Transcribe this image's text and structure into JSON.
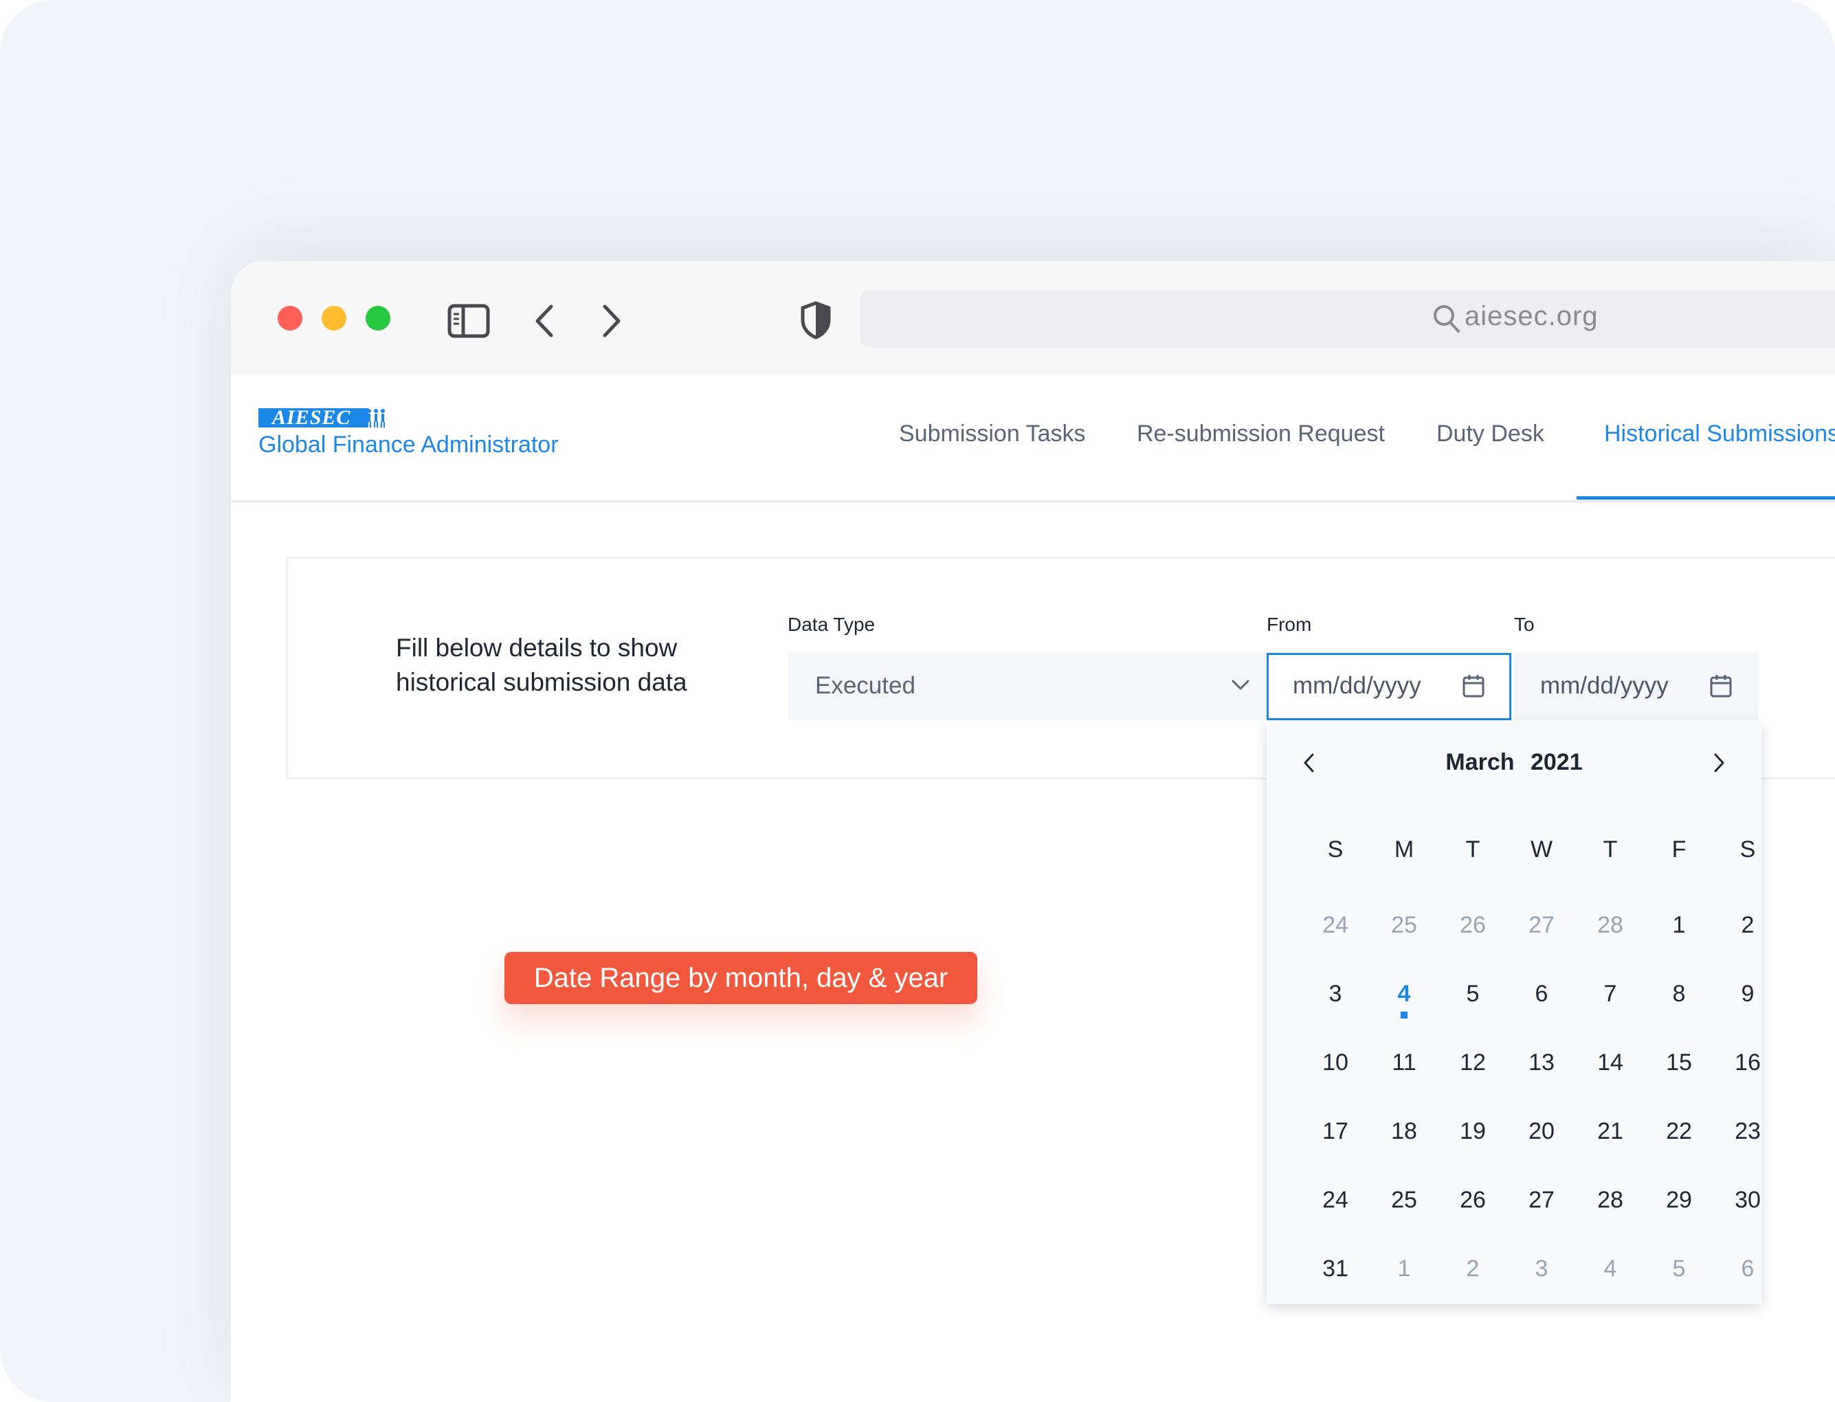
{
  "browser": {
    "url": "aiesec.org",
    "icons": [
      "sidebar-toggle-icon",
      "back-icon",
      "forward-icon",
      "shield-icon",
      "search-icon"
    ]
  },
  "app": {
    "logo_text": "AIESEC",
    "title": "Global Finance Administrator",
    "nav": [
      {
        "label": "Submission Tasks",
        "active": false
      },
      {
        "label": "Re-submission Request",
        "active": false
      },
      {
        "label": "Duty Desk",
        "active": false
      },
      {
        "label": "Historical Submissions",
        "active": true
      }
    ],
    "accent_color": "#1b87e6"
  },
  "form": {
    "intro_line1": "Fill below details to show",
    "intro_line2": "historical submission data",
    "data_type_label": "Data Type",
    "data_type_value": "Executed",
    "from_label": "From",
    "from_placeholder": "mm/dd/yyyy",
    "to_label": "To",
    "to_placeholder": "mm/dd/yyyy"
  },
  "calendar": {
    "month": "March",
    "year": "2021",
    "weekdays": [
      "S",
      "M",
      "T",
      "W",
      "T",
      "F",
      "S"
    ],
    "weeks": [
      [
        {
          "d": "24",
          "m": true
        },
        {
          "d": "25",
          "m": true
        },
        {
          "d": "26",
          "m": true
        },
        {
          "d": "27",
          "m": true
        },
        {
          "d": "28",
          "m": true
        },
        {
          "d": "1"
        },
        {
          "d": "2"
        }
      ],
      [
        {
          "d": "3"
        },
        {
          "d": "4",
          "today": true
        },
        {
          "d": "5"
        },
        {
          "d": "6"
        },
        {
          "d": "7"
        },
        {
          "d": "8"
        },
        {
          "d": "9"
        }
      ],
      [
        {
          "d": "10"
        },
        {
          "d": "11"
        },
        {
          "d": "12"
        },
        {
          "d": "13"
        },
        {
          "d": "14"
        },
        {
          "d": "15"
        },
        {
          "d": "16"
        }
      ],
      [
        {
          "d": "17"
        },
        {
          "d": "18"
        },
        {
          "d": "19"
        },
        {
          "d": "20"
        },
        {
          "d": "21"
        },
        {
          "d": "22"
        },
        {
          "d": "23"
        }
      ],
      [
        {
          "d": "24"
        },
        {
          "d": "25"
        },
        {
          "d": "26"
        },
        {
          "d": "27"
        },
        {
          "d": "28"
        },
        {
          "d": "29"
        },
        {
          "d": "30"
        }
      ],
      [
        {
          "d": "31"
        },
        {
          "d": "1",
          "m": true
        },
        {
          "d": "2",
          "m": true
        },
        {
          "d": "3",
          "m": true
        },
        {
          "d": "4",
          "m": true
        },
        {
          "d": "5",
          "m": true
        },
        {
          "d": "6",
          "m": true
        }
      ]
    ]
  },
  "annotation": {
    "text": "Date Range by month, day & year",
    "color": "#f2583d"
  }
}
